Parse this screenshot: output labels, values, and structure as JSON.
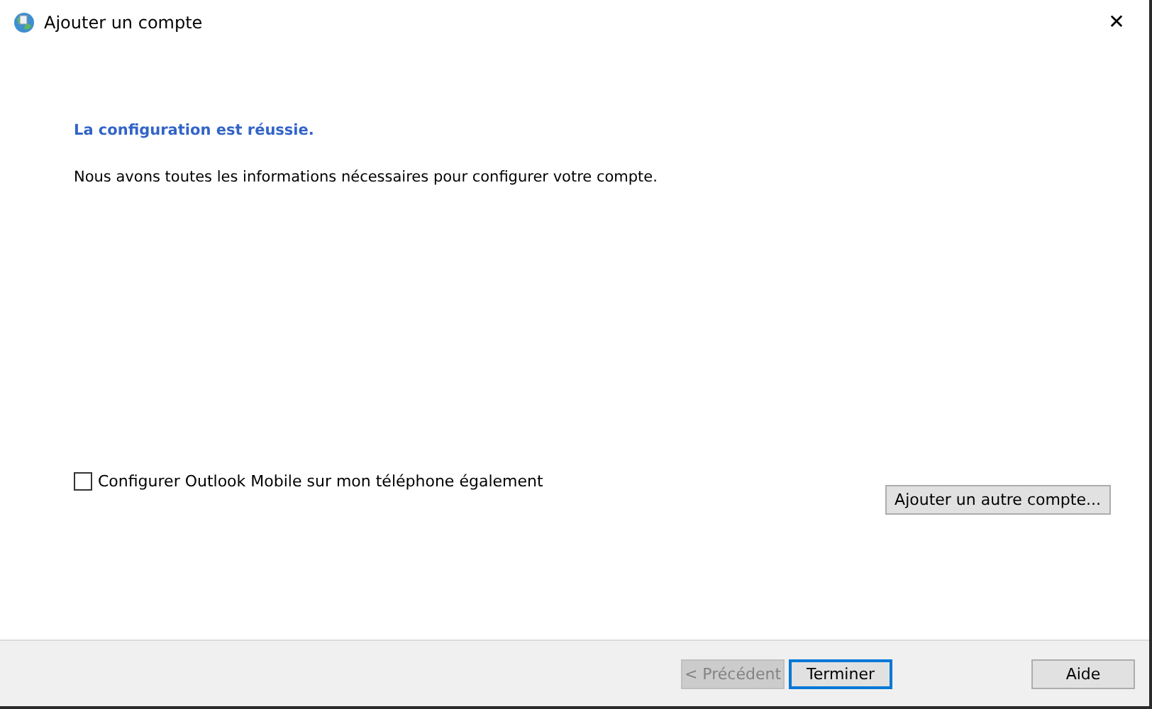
{
  "window": {
    "title": "Ajouter un compte",
    "close": "✕"
  },
  "heading": "La configuration est réussie.",
  "message": "Nous avons toutes les informations nécessaires pour configurer votre compte.",
  "mobile_option": {
    "label": "Configurer Outlook Mobile sur mon téléphone également",
    "checked": false
  },
  "add_account_button": "Ajouter un autre compte...",
  "buttons": [
    {
      "label": "< Précédent",
      "disabled": true,
      "default": false
    },
    {
      "label": "Terminer",
      "disabled": false,
      "default": true
    },
    {
      "label": "Aide",
      "disabled": false,
      "default": false
    }
  ]
}
